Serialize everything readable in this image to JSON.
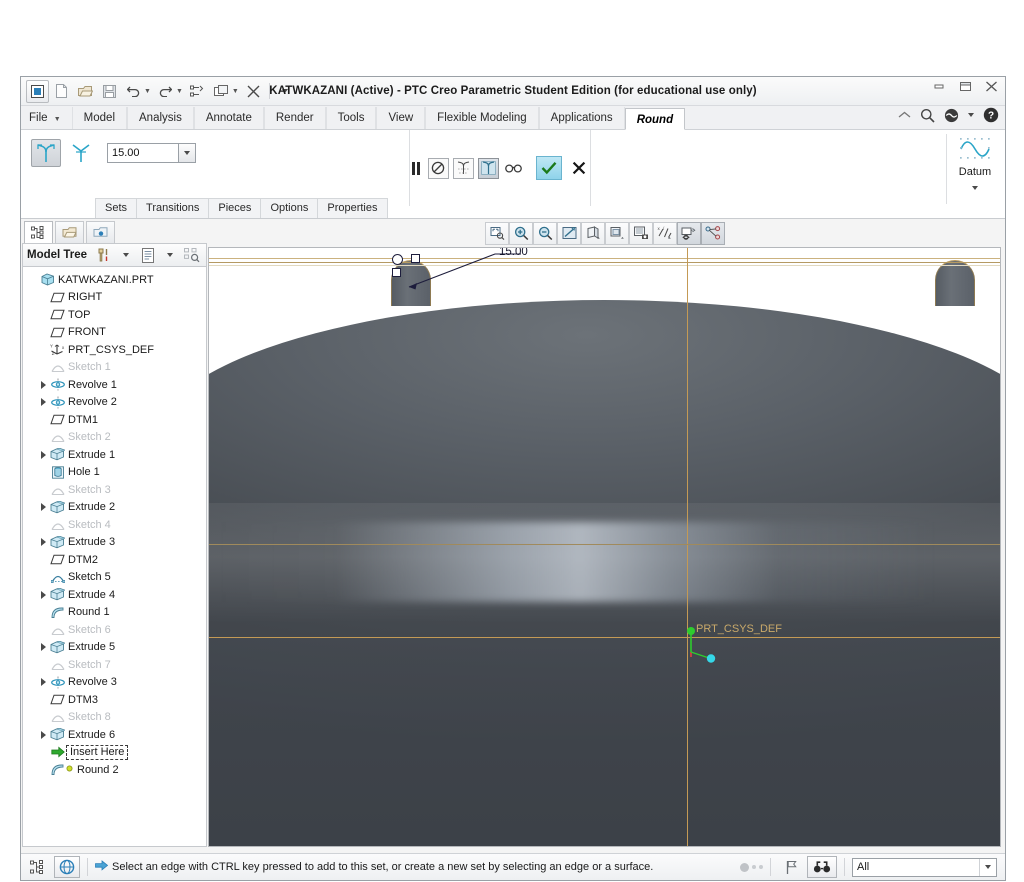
{
  "window": {
    "title": "KATWKAZANI (Active) - PTC Creo Parametric Student Edition (for educational use only)",
    "minimize": "–",
    "restore": "❐",
    "close": "✕"
  },
  "quick_access": {
    "items": [
      {
        "name": "creo-app-icon",
        "glyph": "app"
      },
      {
        "name": "new-file-icon",
        "glyph": "doc"
      },
      {
        "name": "open-file-icon",
        "glyph": "folder"
      },
      {
        "name": "save-icon",
        "glyph": "save"
      },
      {
        "name": "undo-icon",
        "glyph": "undo"
      },
      {
        "name": "redo-icon",
        "glyph": "redo"
      },
      {
        "name": "regenerate-icon",
        "glyph": "regen"
      },
      {
        "name": "window-switch-icon",
        "glyph": "windows"
      },
      {
        "name": "close-window-icon",
        "glyph": "closewin"
      },
      {
        "name": "customize-qat-icon",
        "glyph": "caret"
      }
    ]
  },
  "ribbon": {
    "tabs": [
      {
        "label": "File",
        "active": false,
        "dropdown": true
      },
      {
        "label": "Model",
        "active": false
      },
      {
        "label": "Analysis",
        "active": false
      },
      {
        "label": "Annotate",
        "active": false
      },
      {
        "label": "Render",
        "active": false
      },
      {
        "label": "Tools",
        "active": false
      },
      {
        "label": "View",
        "active": false
      },
      {
        "label": "Flexible Modeling",
        "active": false
      },
      {
        "label": "Applications",
        "active": false
      },
      {
        "label": "Round",
        "active": true
      }
    ],
    "right_icons": [
      {
        "name": "minimize-ribbon-icon"
      },
      {
        "name": "search-icon"
      },
      {
        "name": "help-center-icon"
      },
      {
        "name": "help-dropdown-caret-icon"
      },
      {
        "name": "help-question-icon"
      }
    ]
  },
  "dashboard": {
    "round_type_buttons": [
      {
        "name": "circular-round-button",
        "pressed": true
      },
      {
        "name": "conic-round-button",
        "pressed": false
      }
    ],
    "radius_value": "15.00",
    "radius_placeholder": "15.00",
    "sub_tabs": [
      "Sets",
      "Transitions",
      "Pieces",
      "Options",
      "Properties"
    ],
    "controls": [
      {
        "name": "pause-button",
        "label": "Pause"
      },
      {
        "name": "no-preview-button",
        "label": "No Preview"
      },
      {
        "name": "wireframe-preview-button",
        "label": "Wireframe Preview"
      },
      {
        "name": "shaded-preview-button",
        "label": "Shaded Preview",
        "active": true
      },
      {
        "name": "glasses-preview-button",
        "label": "Preview"
      }
    ],
    "accept_label": "✔",
    "cancel_label": "✕",
    "datum_group": {
      "label": "Datum",
      "icon": "datum-curve-icon"
    }
  },
  "navigator": {
    "tabs": [
      {
        "name": "model-tree-tab",
        "active": true
      },
      {
        "name": "folder-browser-tab",
        "active": false
      },
      {
        "name": "favorites-tab",
        "active": false
      }
    ],
    "tree_header": {
      "title": "Model Tree",
      "buttons": [
        {
          "name": "tree-tools-icon"
        },
        {
          "name": "tree-tools-caret-icon"
        },
        {
          "name": "tree-settings-icon"
        },
        {
          "name": "tree-settings-caret-icon"
        },
        {
          "name": "tree-filter-icon"
        }
      ]
    },
    "tree": [
      {
        "label": "KATWKAZANI.PRT",
        "icon": "part-icon",
        "indent": 0,
        "arrow": false,
        "dim": false
      },
      {
        "label": "RIGHT",
        "icon": "datum-plane-icon",
        "indent": 1,
        "arrow": false,
        "dim": false
      },
      {
        "label": "TOP",
        "icon": "datum-plane-icon",
        "indent": 1,
        "arrow": false,
        "dim": false
      },
      {
        "label": "FRONT",
        "icon": "datum-plane-icon",
        "indent": 1,
        "arrow": false,
        "dim": false
      },
      {
        "label": "PRT_CSYS_DEF",
        "icon": "csys-icon",
        "indent": 1,
        "arrow": false,
        "dim": false
      },
      {
        "label": "Sketch 1",
        "icon": "sketch-icon",
        "indent": 1,
        "arrow": false,
        "dim": true
      },
      {
        "label": "Revolve 1",
        "icon": "revolve-icon",
        "indent": 1,
        "arrow": true,
        "dim": false
      },
      {
        "label": "Revolve 2",
        "icon": "revolve-icon",
        "indent": 1,
        "arrow": true,
        "dim": false
      },
      {
        "label": "DTM1",
        "icon": "datum-plane-icon",
        "indent": 1,
        "arrow": false,
        "dim": false
      },
      {
        "label": "Sketch 2",
        "icon": "sketch-icon",
        "indent": 1,
        "arrow": false,
        "dim": true
      },
      {
        "label": "Extrude 1",
        "icon": "extrude-icon",
        "indent": 1,
        "arrow": true,
        "dim": false
      },
      {
        "label": "Hole 1",
        "icon": "hole-icon",
        "indent": 1,
        "arrow": false,
        "dim": false
      },
      {
        "label": "Sketch 3",
        "icon": "sketch-icon",
        "indent": 1,
        "arrow": false,
        "dim": true
      },
      {
        "label": "Extrude 2",
        "icon": "extrude-icon",
        "indent": 1,
        "arrow": true,
        "dim": false
      },
      {
        "label": "Sketch 4",
        "icon": "sketch-icon",
        "indent": 1,
        "arrow": false,
        "dim": true
      },
      {
        "label": "Extrude 3",
        "icon": "extrude-icon",
        "indent": 1,
        "arrow": true,
        "dim": false
      },
      {
        "label": "DTM2",
        "icon": "datum-plane-icon",
        "indent": 1,
        "arrow": false,
        "dim": false
      },
      {
        "label": "Sketch 5",
        "icon": "sketch-active-icon",
        "indent": 1,
        "arrow": false,
        "dim": false
      },
      {
        "label": "Extrude 4",
        "icon": "extrude-icon",
        "indent": 1,
        "arrow": true,
        "dim": false
      },
      {
        "label": "Round 1",
        "icon": "round-icon",
        "indent": 1,
        "arrow": false,
        "dim": false
      },
      {
        "label": "Sketch 6",
        "icon": "sketch-icon",
        "indent": 1,
        "arrow": false,
        "dim": true
      },
      {
        "label": "Extrude 5",
        "icon": "extrude-icon",
        "indent": 1,
        "arrow": true,
        "dim": false
      },
      {
        "label": "Sketch 7",
        "icon": "sketch-icon",
        "indent": 1,
        "arrow": false,
        "dim": true
      },
      {
        "label": "Revolve 3",
        "icon": "revolve-icon",
        "indent": 1,
        "arrow": true,
        "dim": false
      },
      {
        "label": "DTM3",
        "icon": "datum-plane-icon",
        "indent": 1,
        "arrow": false,
        "dim": false
      },
      {
        "label": "Sketch 8",
        "icon": "sketch-icon",
        "indent": 1,
        "arrow": false,
        "dim": true
      },
      {
        "label": "Extrude 6",
        "icon": "extrude-icon",
        "indent": 1,
        "arrow": true,
        "dim": false
      },
      {
        "label": "Insert Here",
        "icon": "insert-here-arrow-icon",
        "indent": 1,
        "arrow": false,
        "dim": false,
        "boxed": true
      },
      {
        "label": "Round 2",
        "icon": "round-edit-icon",
        "indent": 1,
        "arrow": false,
        "dim": false
      }
    ]
  },
  "graphics_toolbar": [
    {
      "name": "refit-zoom-icon"
    },
    {
      "name": "zoom-in-icon"
    },
    {
      "name": "zoom-out-icon"
    },
    {
      "name": "repaint-icon"
    },
    {
      "name": "display-style-icon"
    },
    {
      "name": "saved-orientations-icon"
    },
    {
      "name": "view-manager-icon"
    },
    {
      "name": "datum-display-filters-icon"
    },
    {
      "name": "annotation-display-icon",
      "active": true
    },
    {
      "name": "spin-center-icon",
      "active": true
    }
  ],
  "viewport": {
    "dimension_label": "15.00",
    "csys_label": "PRT_CSYS_DEF",
    "handles": [
      {
        "name": "round-radius-drag-handle",
        "type": "square"
      },
      {
        "name": "round-reference-handle",
        "type": "square"
      },
      {
        "name": "round-set-handle",
        "type": "circle"
      }
    ]
  },
  "statusbar": {
    "left_buttons": [
      {
        "name": "model-tree-toggle-button"
      },
      {
        "name": "web-browser-toggle-button"
      }
    ],
    "message": "Select an edge with CTRL key pressed to add to this set, or create a new set by selecting an edge or a surface.",
    "right_buttons": [
      {
        "name": "process-indicator"
      },
      {
        "name": "flag-icon"
      },
      {
        "name": "search-selection-button"
      }
    ],
    "filter_value": "All"
  },
  "colors": {
    "accent": "#8fd3ea",
    "csys_gold": "#c49a55",
    "model_dark": "#474c52",
    "model_light": "#6c7278",
    "title_bg": "#eef0f2"
  }
}
